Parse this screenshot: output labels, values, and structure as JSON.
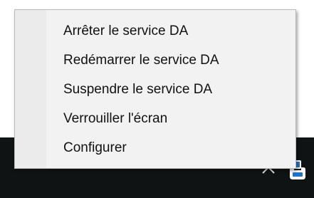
{
  "context_menu": {
    "items": [
      {
        "label": "Arrêter le service DA"
      },
      {
        "label": "Redémarrer le service DA"
      },
      {
        "label": "Suspendre le service DA"
      },
      {
        "label": "Verrouiller l'écran"
      },
      {
        "label": "Configurer"
      }
    ]
  },
  "taskbar": {
    "background": "#101314",
    "icons": [
      "chevron-up-icon",
      "da-service-tray-icon"
    ]
  },
  "colors": {
    "menu_background": "#f2f2f2",
    "menu_border": "#b9b9b9",
    "text": "#111111"
  }
}
